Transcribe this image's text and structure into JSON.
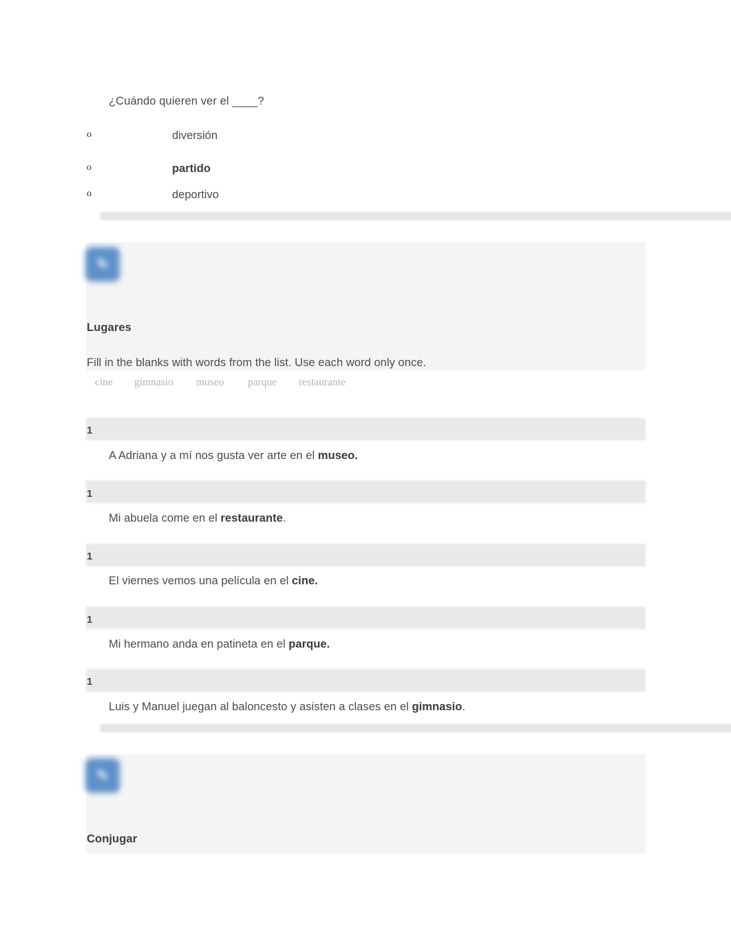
{
  "top_question": {
    "stem": "¿Cuándo quieren ver el ____?",
    "choices": [
      {
        "marker": "o",
        "text": "diversión",
        "bold": false
      },
      {
        "marker": "o",
        "text": "partido",
        "bold": true
      },
      {
        "marker": "o",
        "text": "deportivo",
        "bold": false
      }
    ]
  },
  "activity_lugares": {
    "icon_glyph": "✎",
    "icon_color": "#5d90ca",
    "title": "Lugares",
    "instructions": "Fill in the blanks with words from the list. Use each word only once.",
    "word_bank": [
      "cine",
      "gimnasio",
      "museo",
      "parque",
      "restaurante"
    ],
    "items": [
      {
        "number": "1",
        "prefix": "A Adriana y a mí nos gusta ver arte en el ",
        "answer": "museo.",
        "suffix": ""
      },
      {
        "number": "1",
        "prefix": "Mi abuela come en el ",
        "answer": "restaurante",
        "suffix": "."
      },
      {
        "number": "1",
        "prefix": "El viernes vemos una película en el ",
        "answer": "cine.",
        "suffix": ""
      },
      {
        "number": "1",
        "prefix": "Mi hermano anda en patineta en el ",
        "answer": "parque.",
        "suffix": ""
      },
      {
        "number": "1",
        "prefix": "Luis y Manuel juegan al baloncesto y asisten a clases en el ",
        "answer": "gimnasio",
        "suffix": "."
      }
    ]
  },
  "activity_conjugar": {
    "icon_glyph": "✎",
    "icon_color": "#5d90ca",
    "title": "Conjugar"
  }
}
